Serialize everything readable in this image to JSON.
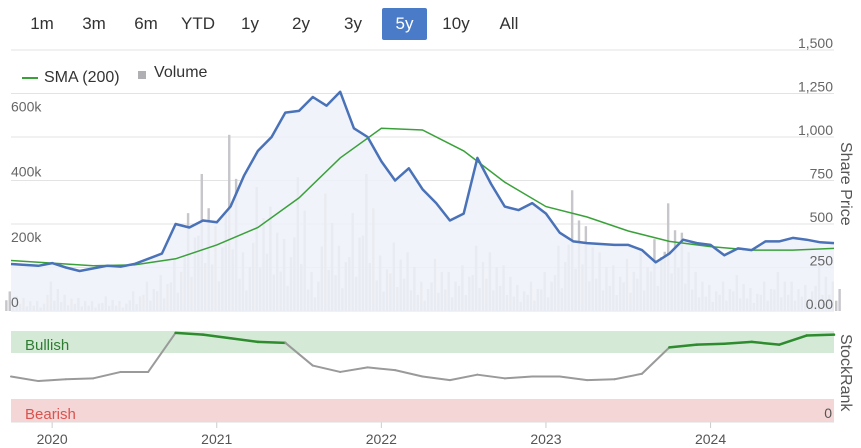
{
  "range_selector": {
    "buttons": [
      "1m",
      "3m",
      "6m",
      "YTD",
      "1y",
      "2y",
      "3y",
      "5y",
      "10y",
      "All"
    ],
    "active": "5y"
  },
  "legend": {
    "sma_label": "SMA (200)",
    "volume_label": "Volume"
  },
  "colors": {
    "price": "#4a72b8",
    "sma": "#3aa13a",
    "volume": "#c6c6cb",
    "active_button": "#4a7bc8",
    "bullish_band": "#d4ead6",
    "bearish_band": "#f5d6d6",
    "stockrank_line_bullish": "#2e8b2e",
    "stockrank_line_neutral": "#9a9a9a"
  },
  "chart_data": [
    {
      "type": "line",
      "ylabel": "Share Price",
      "ylim": [
        0,
        1500
      ],
      "yticks": [
        "0.00",
        "250",
        "500",
        "750",
        "1,000",
        "1,250",
        "1,500"
      ],
      "volume_ticks": [
        "0",
        "200k",
        "400k",
        "600k"
      ],
      "volume_ylim": [
        0,
        800000
      ],
      "x_tick_labels": [
        "2020",
        "2021",
        "2022",
        "2023",
        "2024"
      ],
      "x_range": [
        "2019-10",
        "2024-10"
      ],
      "series": [
        {
          "name": "Price",
          "x": [
            "2019-10",
            "2019-11",
            "2019-12",
            "2020-01",
            "2020-02",
            "2020-03",
            "2020-04",
            "2020-05",
            "2020-06",
            "2020-07",
            "2020-08",
            "2020-09",
            "2020-10",
            "2020-11",
            "2020-12",
            "2021-01",
            "2021-02",
            "2021-03",
            "2021-04",
            "2021-05",
            "2021-06",
            "2021-07",
            "2021-08",
            "2021-09",
            "2021-10",
            "2021-11",
            "2021-12",
            "2022-01",
            "2022-02",
            "2022-03",
            "2022-04",
            "2022-05",
            "2022-06",
            "2022-07",
            "2022-08",
            "2022-09",
            "2022-10",
            "2022-11",
            "2022-12",
            "2023-01",
            "2023-02",
            "2023-03",
            "2023-04",
            "2023-05",
            "2023-06",
            "2023-07",
            "2023-08",
            "2023-09",
            "2023-10",
            "2023-11",
            "2023-12",
            "2024-01",
            "2024-02",
            "2024-03",
            "2024-04",
            "2024-05",
            "2024-06",
            "2024-07",
            "2024-08",
            "2024-09",
            "2024-10"
          ],
          "values": [
            270,
            265,
            260,
            275,
            250,
            230,
            245,
            260,
            255,
            270,
            300,
            330,
            500,
            480,
            520,
            510,
            600,
            780,
            920,
            1000,
            1140,
            1150,
            1230,
            1180,
            1260,
            1050,
            1000,
            860,
            750,
            820,
            700,
            620,
            520,
            560,
            880,
            730,
            600,
            580,
            620,
            560,
            450,
            400,
            390,
            385,
            380,
            380,
            350,
            280,
            330,
            410,
            390,
            380,
            320,
            360,
            350,
            400,
            400,
            420,
            410,
            395,
            390
          ]
        },
        {
          "name": "SMA (200)",
          "x": [
            "2019-10",
            "2020-01",
            "2020-04",
            "2020-07",
            "2020-10",
            "2021-01",
            "2021-04",
            "2021-07",
            "2021-10",
            "2022-01",
            "2022-04",
            "2022-07",
            "2022-10",
            "2023-01",
            "2023-04",
            "2023-07",
            "2023-10",
            "2024-01",
            "2024-04",
            "2024-07",
            "2024-10"
          ],
          "values": [
            290,
            275,
            260,
            265,
            300,
            380,
            480,
            650,
            880,
            1050,
            1040,
            920,
            740,
            600,
            540,
            460,
            400,
            370,
            350,
            350,
            360
          ]
        }
      ],
      "volume": [
        60,
        40,
        30,
        90,
        50,
        40,
        30,
        45,
        30,
        60,
        90,
        110,
        160,
        300,
        420,
        260,
        540,
        180,
        380,
        320,
        220,
        410,
        120,
        360,
        200,
        300,
        420,
        170,
        210,
        180,
        90,
        160,
        120,
        140,
        200,
        180,
        140,
        80,
        90,
        120,
        200,
        370,
        260,
        180,
        140,
        160,
        180,
        220,
        330,
        240,
        120,
        80,
        90,
        110,
        70,
        90,
        120,
        90,
        80,
        140,
        90
      ]
    },
    {
      "type": "line",
      "ylabel": "StockRank",
      "ylim": [
        0,
        100
      ],
      "yticks": [
        "0"
      ],
      "band_labels": {
        "bullish": "Bullish",
        "bearish": "Bearish"
      },
      "series": [
        {
          "name": "StockRank",
          "x": [
            "2019-10",
            "2019-12",
            "2020-02",
            "2020-04",
            "2020-06",
            "2020-08",
            "2020-10",
            "2020-12",
            "2021-02",
            "2021-04",
            "2021-06",
            "2021-08",
            "2021-10",
            "2021-12",
            "2022-02",
            "2022-04",
            "2022-06",
            "2022-08",
            "2022-10",
            "2022-12",
            "2023-02",
            "2023-04",
            "2023-06",
            "2023-08",
            "2023-10",
            "2023-12",
            "2024-02",
            "2024-04",
            "2024-06",
            "2024-08",
            "2024-10"
          ],
          "values": [
            50,
            45,
            47,
            48,
            55,
            55,
            98,
            96,
            92,
            88,
            87,
            62,
            55,
            60,
            57,
            50,
            46,
            52,
            48,
            50,
            50,
            46,
            47,
            53,
            82,
            85,
            86,
            88,
            85,
            95,
            96
          ]
        }
      ]
    }
  ]
}
